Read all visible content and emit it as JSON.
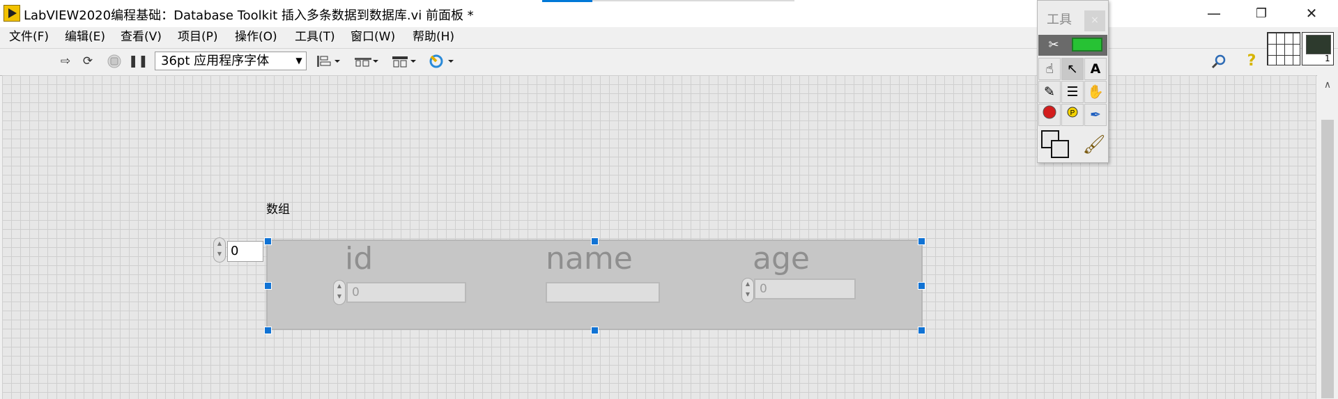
{
  "window": {
    "title": "LabVIEW2020编程基础：Database Toolkit 插入多条数据到数据库.vi 前面板 *",
    "minimize_glyph": "—",
    "restore_glyph": "❐",
    "close_glyph": "✕"
  },
  "menu": {
    "items": [
      "文件(F)",
      "编辑(E)",
      "查看(V)",
      "项目(P)",
      "操作(O)",
      "工具(T)",
      "窗口(W)",
      "帮助(H)"
    ]
  },
  "toolbar": {
    "run_icon": "run-arrow-icon",
    "run_continuous_icon": "run-continuously-icon",
    "abort_icon": "abort-icon",
    "pause_icon": "pause-icon",
    "font_select_value": "36pt 应用程序字体",
    "align_icon": "align-objects-icon",
    "distribute_icon": "distribute-objects-icon",
    "resize_icon": "resize-objects-icon",
    "reorder_icon": "reorder-icon",
    "search_icon": "search-icon",
    "help_icon": "context-help-icon",
    "help_glyph": "?"
  },
  "front_panel": {
    "array_label": "数组",
    "index_value": "0",
    "cluster_fields": [
      {
        "label": "id",
        "value": "0",
        "has_spinner": true
      },
      {
        "label": "name",
        "value": "",
        "has_spinner": false
      },
      {
        "label": "age",
        "value": "0",
        "has_spinner": true
      }
    ]
  },
  "tools_palette": {
    "title": "工具",
    "close_glyph": "×",
    "tools": [
      "operate-value-tool-icon",
      "position-select-tool-icon",
      "edit-text-tool-icon",
      "connect-wire-tool-icon",
      "shortcut-menu-tool-icon",
      "scroll-window-tool-icon",
      "breakpoint-tool-icon",
      "probe-tool-icon",
      "get-color-tool-icon"
    ],
    "colors": {
      "foreground": "#e8e8e8",
      "background": "#e8e8e8"
    }
  },
  "colors": {
    "accent": "#1173d4",
    "auto_tool_led": "#27c234",
    "canvas_grid": "#e7e7e7"
  }
}
